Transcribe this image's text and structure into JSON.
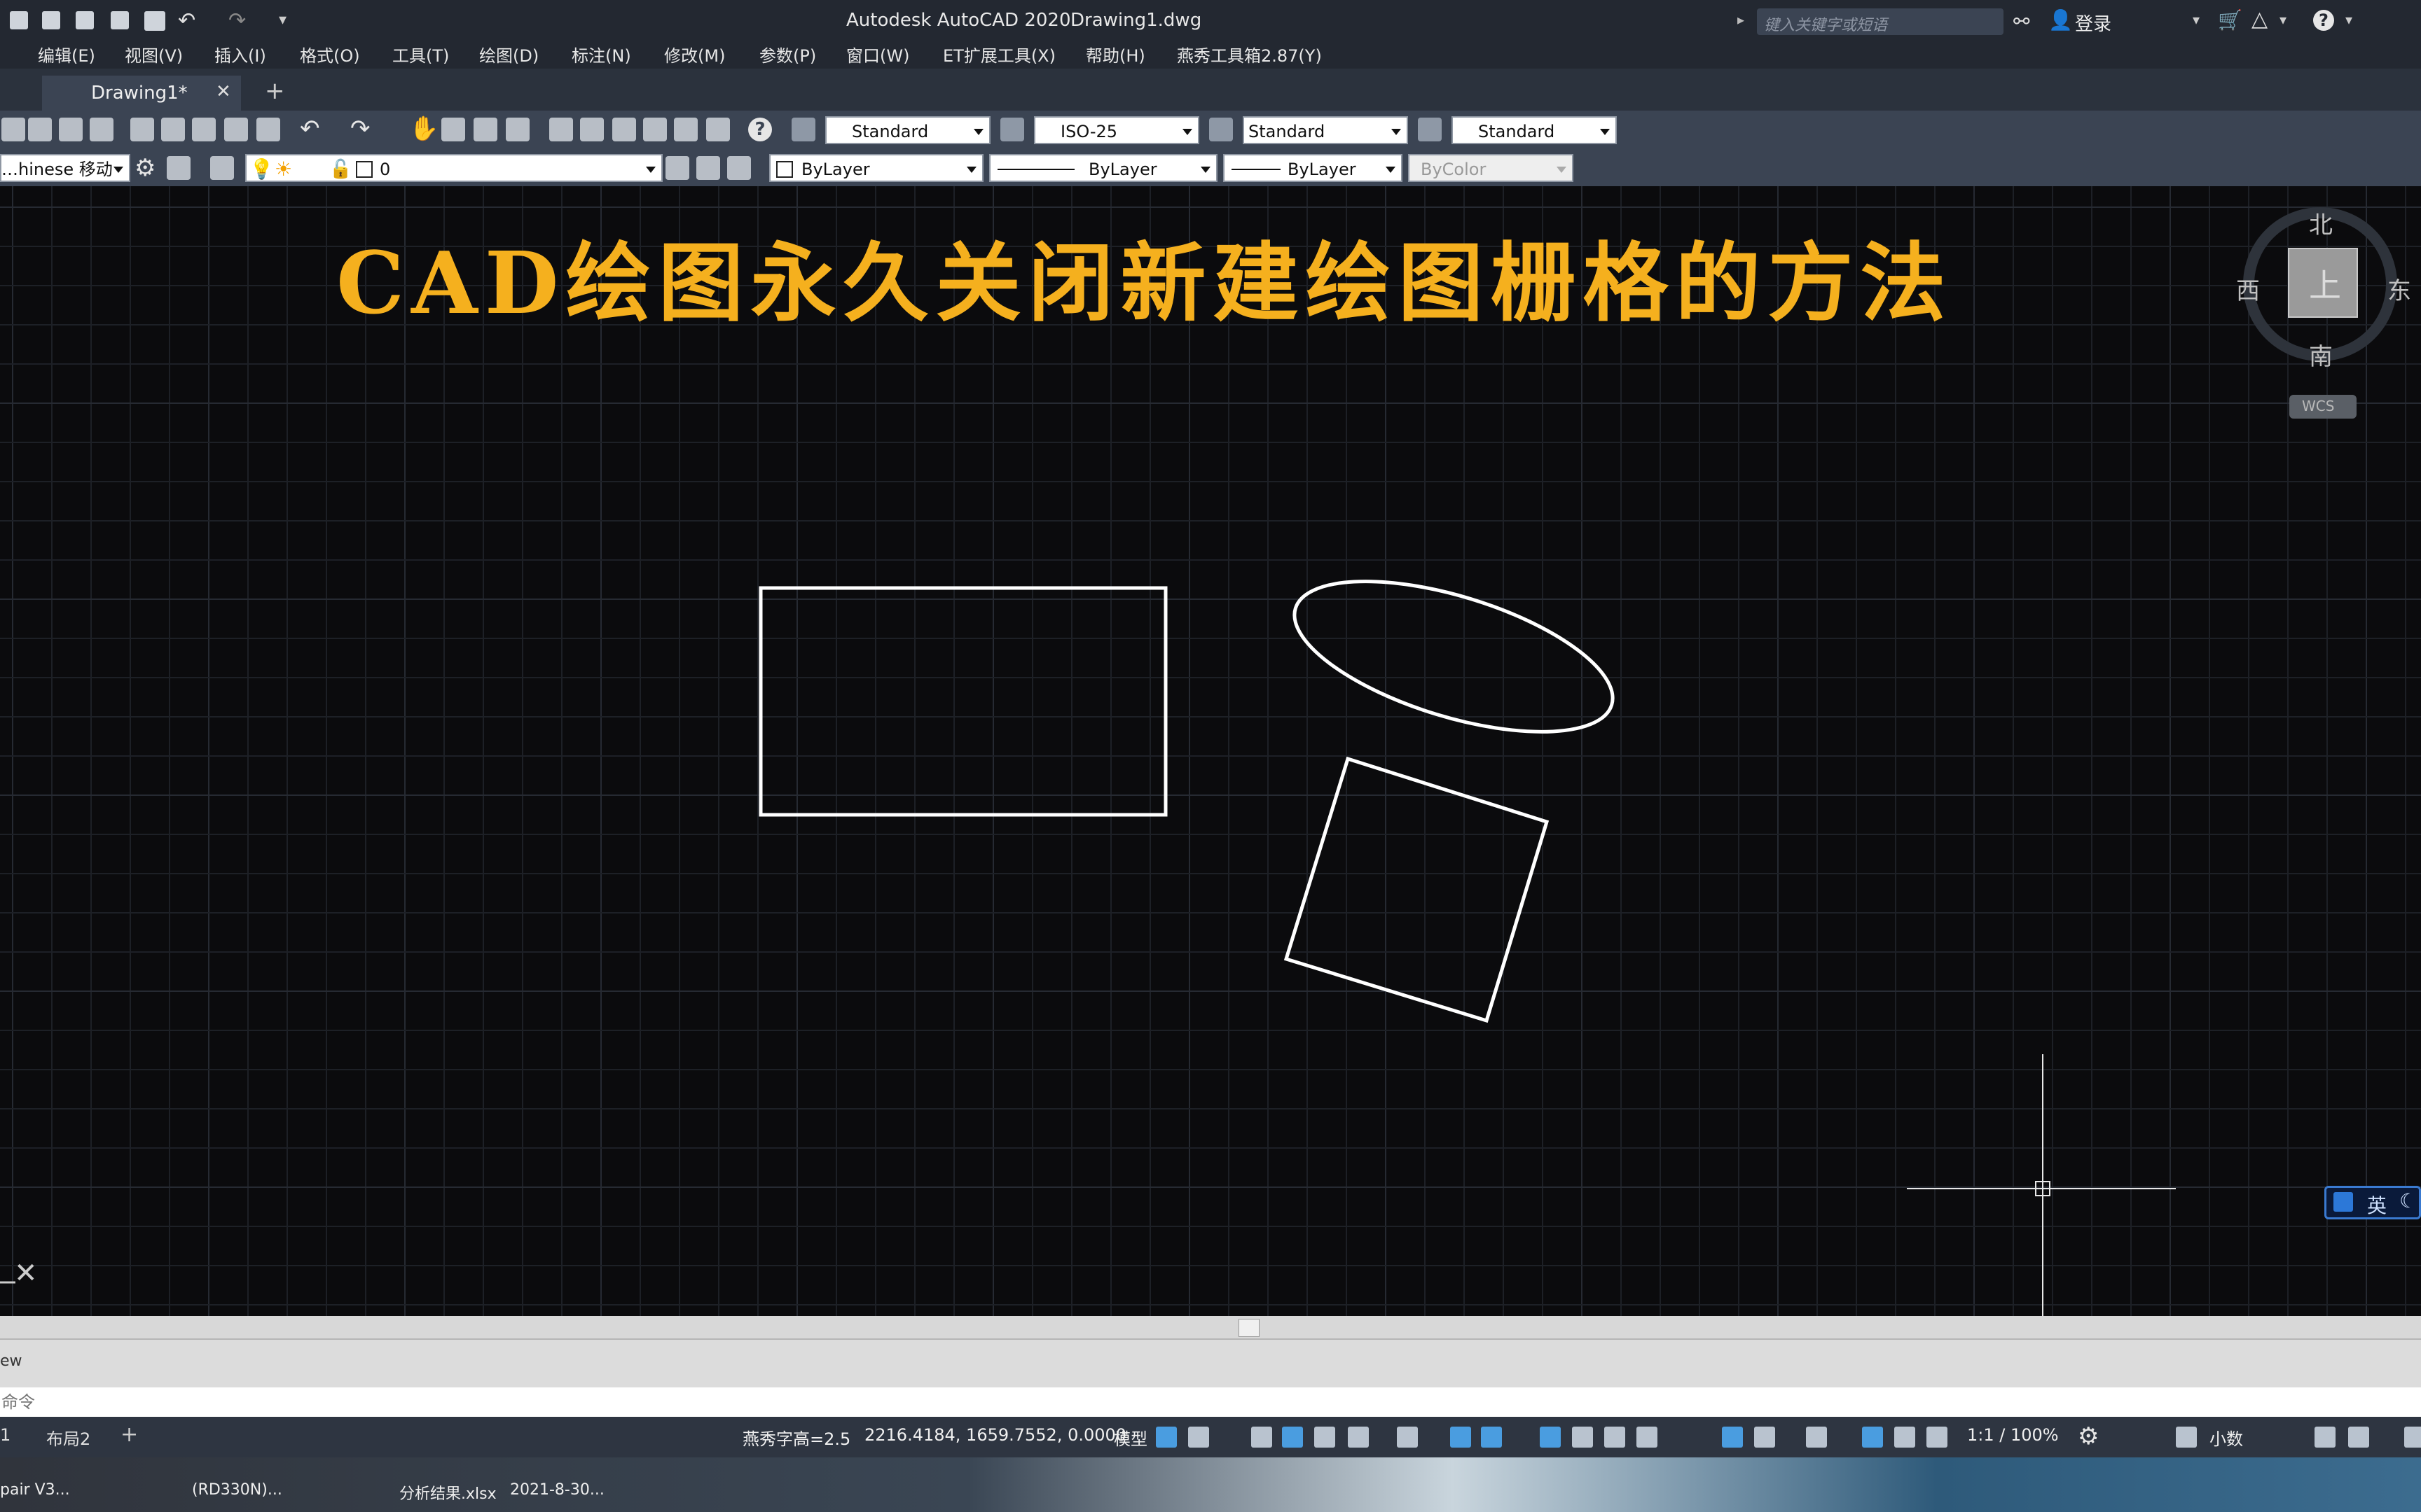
{
  "titlebar": {
    "app_title": "Autodesk AutoCAD 2020",
    "doc_title": "Drawing1.dwg",
    "search_placeholder": "键入关键字或短语",
    "login_label": "登录"
  },
  "menus": [
    "编辑(E)",
    "视图(V)",
    "插入(I)",
    "格式(O)",
    "工具(T)",
    "绘图(D)",
    "标注(N)",
    "修改(M)",
    "参数(P)",
    "窗口(W)",
    "ET扩展工具(X)",
    "帮助(H)",
    "燕秀工具箱2.87(Y)"
  ],
  "tabs": {
    "active_tab": "Drawing1*",
    "close_glyph": "✕",
    "add_glyph": "+"
  },
  "toolbar1": {
    "text_style": "Standard",
    "dim_style": "ISO-25",
    "table_style": "Standard",
    "mleader_style": "Standard"
  },
  "toolbar2": {
    "workspace": "…hinese 移动",
    "layer": "0",
    "color": "ByLayer",
    "linetype": "ByLayer",
    "lineweight": "ByLayer",
    "plot_style": "ByColor"
  },
  "canvas": {
    "title": "CAD绘图永久关闭新建绘图栅格的方法",
    "ucs_close": "✕"
  },
  "viewcube": {
    "north": "北",
    "south": "南",
    "east": "东",
    "west": "西",
    "face": "上",
    "wcs": "WCS"
  },
  "ime": {
    "label": "英"
  },
  "command": {
    "history_text": "ew",
    "prompt_placeholder": "命令"
  },
  "layouts": {
    "tab1": "1",
    "tab2": "布局2",
    "add_glyph": "+"
  },
  "statusbar": {
    "font_height": "燕秀字高=2.5",
    "coordinates": "2216.4184, 1659.7552, 0.0000",
    "model": "模型",
    "scale": "1:1 / 100%",
    "units": "小数"
  },
  "taskbar": {
    "item1": "pair V3...",
    "item2": "(RD330N)...",
    "item3": "分析结果.xlsx",
    "item4": "2021-8-30..."
  },
  "colors": {
    "title_accent": "#f5b01e",
    "canvas_bg": "#0b0b0d",
    "grid_line": "#1d2026",
    "grid_major": "#262a32",
    "geometry": "#ffffff"
  }
}
